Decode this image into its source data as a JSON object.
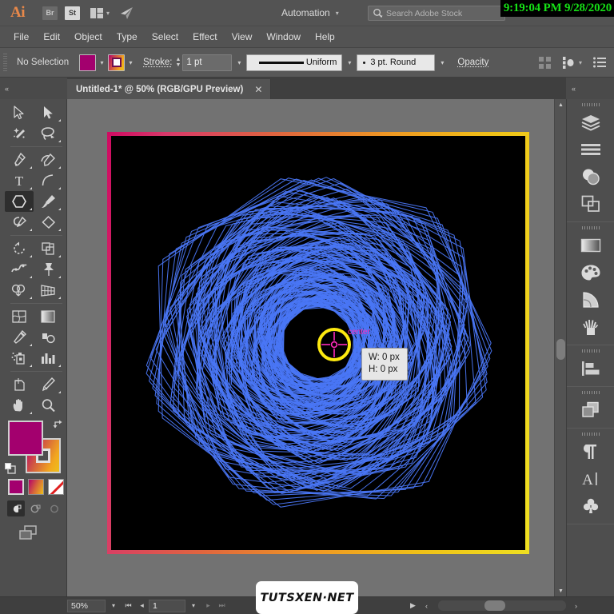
{
  "app": {
    "logo": "Ai",
    "bridge_label": "Br",
    "stock_label": "St",
    "arrange_icon": "arrange-documents-icon",
    "share_icon": "share-icon",
    "workspace": "Automation",
    "workspace_chevron": "chevron-down-icon",
    "search_icon": "search-adobe-stock-icon",
    "search_placeholder": "Search Adobe Stock",
    "search_value": "",
    "clock": "9:19:04 PM 9/28/2020",
    "clock_color": "#16e016"
  },
  "menu": {
    "items": [
      "File",
      "Edit",
      "Object",
      "Type",
      "Select",
      "Effect",
      "View",
      "Window",
      "Help"
    ]
  },
  "control_bar": {
    "selection_status": "No Selection",
    "fill_swatch": {
      "name": "fill-color-swatch",
      "color": "#a3006e"
    },
    "stroke_swatch": {
      "name": "stroke-gradient-swatch",
      "color": "#f2a81e"
    },
    "stroke_label": "Stroke:",
    "stroke_weight": "1 pt",
    "stroke_profile": "Uniform",
    "brush_definition": "3 pt. Round",
    "opacity_label": "Opacity",
    "align_icon": "align-icon",
    "distribute_icon": "distribute-icon",
    "document_setup_icon": "document-setup-icon",
    "chevron": "chevron-down-icon"
  },
  "document": {
    "tab_title": "Untitled-1* @ 50% (RGB/GPU Preview)",
    "close_icon": "close-icon"
  },
  "toolbar": {
    "tools": [
      {
        "name": "selection-tool",
        "icon": "cursor-arrow-outline-icon",
        "has_flyout": false,
        "active": false
      },
      {
        "name": "direct-selection-tool",
        "icon": "cursor-arrow-filled-icon",
        "has_flyout": true,
        "active": false
      },
      {
        "name": "magic-wand-tool",
        "icon": "magic-wand-icon",
        "has_flyout": false,
        "active": false
      },
      {
        "name": "lasso-tool",
        "icon": "lasso-icon",
        "has_flyout": false,
        "active": false
      },
      {
        "name": "pen-tool",
        "icon": "pen-icon",
        "has_flyout": true,
        "active": false
      },
      {
        "name": "curvature-tool",
        "icon": "curvature-pen-icon",
        "has_flyout": true,
        "active": false
      },
      {
        "name": "type-tool",
        "icon": "type-t-icon",
        "has_flyout": true,
        "active": false
      },
      {
        "name": "line-segment-tool",
        "icon": "arc-line-icon",
        "has_flyout": true,
        "active": false
      },
      {
        "name": "shape-tool",
        "icon": "polygon-icon",
        "has_flyout": true,
        "active": true
      },
      {
        "name": "paintbrush-tool",
        "icon": "paintbrush-icon",
        "has_flyout": true,
        "active": false
      },
      {
        "name": "shaper-tool",
        "icon": "shaper-pencil-icon",
        "has_flyout": true,
        "active": false
      },
      {
        "name": "eraser-tool",
        "icon": "eraser-icon",
        "has_flyout": true,
        "active": false
      },
      {
        "name": "rotate-tool",
        "icon": "rotate-icon",
        "has_flyout": true,
        "active": false
      },
      {
        "name": "scale-tool",
        "icon": "scale-icon",
        "has_flyout": true,
        "active": false
      },
      {
        "name": "width-tool",
        "icon": "width-warp-icon",
        "has_flyout": true,
        "active": false
      },
      {
        "name": "free-transform-tool",
        "icon": "pushpin-icon",
        "has_flyout": true,
        "active": false
      },
      {
        "name": "shape-builder-tool",
        "icon": "shape-builder-icon",
        "has_flyout": true,
        "active": false
      },
      {
        "name": "perspective-grid-tool",
        "icon": "perspective-grid-icon",
        "has_flyout": true,
        "active": false
      },
      {
        "name": "mesh-tool",
        "icon": "mesh-icon",
        "has_flyout": false,
        "active": false
      },
      {
        "name": "gradient-tool",
        "icon": "gradient-square-icon",
        "has_flyout": false,
        "active": false
      },
      {
        "name": "eyedropper-tool",
        "icon": "eyedropper-icon",
        "has_flyout": true,
        "active": false
      },
      {
        "name": "blend-tool",
        "icon": "blend-icon",
        "has_flyout": false,
        "active": false
      },
      {
        "name": "symbol-sprayer-tool",
        "icon": "symbol-sprayer-icon",
        "has_flyout": true,
        "active": false
      },
      {
        "name": "column-graph-tool",
        "icon": "bar-graph-icon",
        "has_flyout": true,
        "active": false
      },
      {
        "name": "artboard-tool",
        "icon": "artboard-icon",
        "has_flyout": false,
        "active": false
      },
      {
        "name": "slice-tool",
        "icon": "slice-knife-icon",
        "has_flyout": true,
        "active": false
      },
      {
        "name": "hand-tool",
        "icon": "hand-icon",
        "has_flyout": true,
        "active": false
      },
      {
        "name": "zoom-tool",
        "icon": "magnifier-icon",
        "has_flyout": false,
        "active": false
      }
    ],
    "fill_color": "#a3006e",
    "stroke_gradient": "#f2a81e",
    "swap_icon": "swap-fill-stroke-icon",
    "default_icon": "default-fill-stroke-icon",
    "mini_swatches": [
      {
        "name": "color-mode-button",
        "kind": "solid",
        "selected": true
      },
      {
        "name": "gradient-mode-button",
        "kind": "gradient",
        "selected": false
      },
      {
        "name": "none-mode-button",
        "kind": "none",
        "selected": false
      }
    ],
    "draw_modes": [
      {
        "name": "draw-normal-button",
        "active": true
      },
      {
        "name": "draw-behind-button",
        "active": false
      },
      {
        "name": "draw-inside-button",
        "active": false
      }
    ],
    "screen_mode_icon": "change-screen-mode-icon"
  },
  "canvas": {
    "artwork_name": "blue-spirograph-polygon-artwork",
    "artwork_color": "#4a76f5",
    "artboard_background": "#000000",
    "artboard_border_colors": [
      "#cf0a62",
      "#e0653f",
      "#f0c117",
      "#efe021"
    ],
    "smart_guide_label": "center",
    "smart_guide_color": "#ff2bbd",
    "highlight_ring_color": "#fde910",
    "measure_tooltip": {
      "width": "W: 0 px",
      "height": "H: 0 px"
    }
  },
  "right_dock": {
    "groups": [
      [
        {
          "name": "layers-panel-button",
          "icon": "layers-icon"
        },
        {
          "name": "properties-panel-button",
          "icon": "lines-icon"
        },
        {
          "name": "transparency-panel-button",
          "icon": "transparency-icon"
        },
        {
          "name": "pathfinder-panel-button",
          "icon": "overlap-squares-icon"
        }
      ],
      [
        {
          "name": "gradient-panel-button",
          "icon": "gradient-icon"
        },
        {
          "name": "color-panel-button",
          "icon": "palette-icon"
        },
        {
          "name": "color-guide-panel-button",
          "icon": "color-guide-icon"
        },
        {
          "name": "brushes-panel-button",
          "icon": "brushes-icon"
        }
      ],
      [
        {
          "name": "align-panel-button",
          "icon": "align-left-icon"
        }
      ],
      [
        {
          "name": "appearance-panel-button",
          "icon": "appearance-squares-icon"
        }
      ],
      [
        {
          "name": "paragraph-panel-button",
          "icon": "pilcrow-icon"
        },
        {
          "name": "character-panel-button",
          "icon": "character-a-icon"
        },
        {
          "name": "symbols-panel-button",
          "icon": "clover-symbol-icon"
        }
      ]
    ],
    "collapse_icon": "collapse-panels-icon"
  },
  "status_bar": {
    "zoom_level": "50%",
    "zoom_chevron": "chevron-down-icon",
    "first_artboard_icon": "first-artboard-icon",
    "prev_artboard_icon": "previous-artboard-icon",
    "artboard_number": "1",
    "artboard_chevron": "chevron-down-icon",
    "next_artboard_icon": "next-artboard-icon",
    "last_artboard_icon": "last-artboard-icon",
    "play_icon": "play-icon",
    "scroll_left_icon": "scroll-left-icon",
    "scroll_right_icon": "scroll-right-icon"
  },
  "watermark": {
    "text": "TUTSXEN·NET"
  }
}
